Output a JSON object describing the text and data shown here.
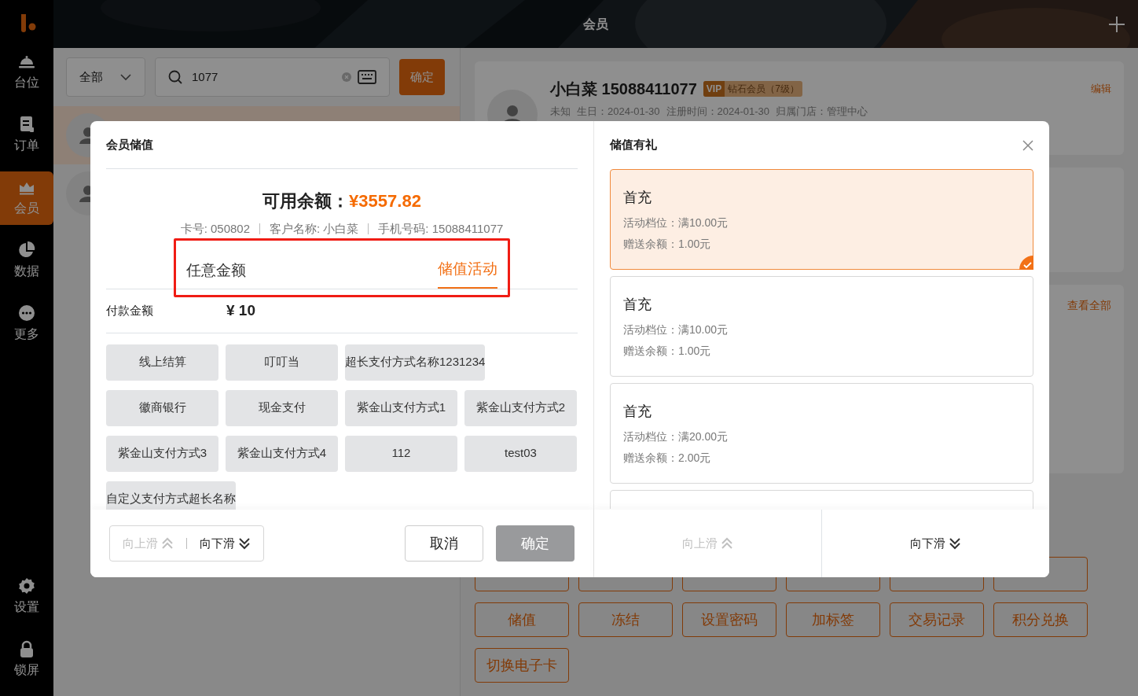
{
  "sidebar": {
    "nav_items": [
      {
        "label": "台位",
        "selected": false
      },
      {
        "label": "订单",
        "selected": false
      },
      {
        "label": "会员",
        "selected": true
      },
      {
        "label": "数据",
        "selected": false
      },
      {
        "label": "更多",
        "selected": false
      }
    ],
    "bottom_items": [
      {
        "label": "设置"
      },
      {
        "label": "锁屏"
      }
    ]
  },
  "header": {
    "title": "会员"
  },
  "member_search": {
    "filter": "全部",
    "search_value": "1077",
    "confirm": "确定"
  },
  "member_list": [
    {
      "selected": true
    },
    {
      "selected": false
    }
  ],
  "member_card": {
    "name": "小白菜 15088411077",
    "vip": "VIP",
    "level": "钻石会员（7级）",
    "edit": "编辑",
    "details": [
      "未知",
      "生日：2024-01-30",
      "注册时间：2024-01-30",
      "归属门店：管理中心"
    ]
  },
  "coupon_card": {
    "link": "查看全部"
  },
  "actions": [
    "储值",
    "冻结",
    "设置密码",
    "加标签",
    "交易记录",
    "积分兑换",
    "切换电子卡"
  ],
  "recharge_dialog": {
    "title": "会员储值",
    "balance_label": "可用余额：",
    "balance": "¥3557.82",
    "card_info": [
      "卡号: 050802",
      "客户名称: 小白菜",
      "手机号码: 15088411077"
    ],
    "tabs": [
      {
        "label": "任意金额",
        "selected": false
      },
      {
        "label": "储值活动",
        "selected": true
      }
    ],
    "tabs_highlighted": true,
    "payment_label": "付款金额",
    "payment_amount": "¥ 10",
    "payment_methods": [
      "线上结算",
      "叮叮当",
      "超长支付方式名称1231234",
      "徽商银行",
      "现金支付",
      "紫金山支付方式1",
      "紫金山支付方式2",
      "紫金山支付方式3",
      "紫金山支付方式4",
      "112",
      "test03",
      "自定义支付方式超长名称"
    ],
    "scroll_up": {
      "label": "向上滑",
      "disabled": true
    },
    "scroll_down": {
      "label": "向下滑",
      "disabled": false
    },
    "cancel": "取消",
    "confirm": {
      "label": "确定",
      "disabled": true
    }
  },
  "gift_panel": {
    "title": "储值有礼",
    "activities": [
      {
        "name": "首充",
        "tier": "活动档位：满10.00元",
        "bonus": "赠送余额：1.00元",
        "selected": true
      },
      {
        "name": "首充",
        "tier": "活动档位：满10.00元",
        "bonus": "赠送余额：1.00元",
        "selected": false
      },
      {
        "name": "首充",
        "tier": "活动档位：满20.00元",
        "bonus": "赠送余额：2.00元",
        "selected": false
      },
      {
        "selected": false
      }
    ],
    "scroll_up": {
      "label": "向上滑",
      "disabled": true
    },
    "scroll_down": {
      "label": "向下滑",
      "disabled": false
    }
  }
}
